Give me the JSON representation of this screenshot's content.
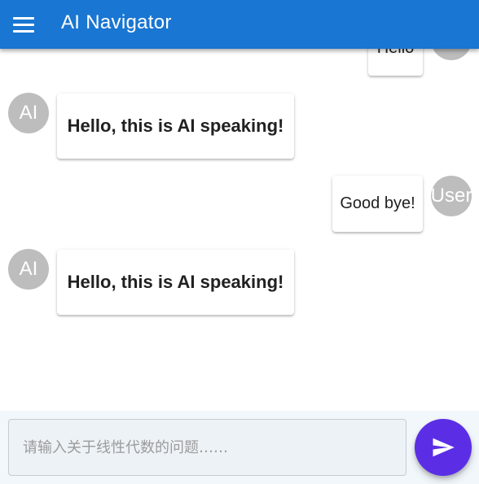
{
  "header": {
    "title": "AI Navigator",
    "menu_icon": "menu-icon"
  },
  "messages": [
    {
      "sender": "user",
      "avatar_text": "",
      "text": "Hello"
    },
    {
      "sender": "ai",
      "avatar_text": "AI",
      "text": "Hello, this is AI speaking!"
    },
    {
      "sender": "user",
      "avatar_text": "User",
      "text": "Good bye!"
    },
    {
      "sender": "ai",
      "avatar_text": "AI",
      "text": "Hello, this is AI speaking!"
    }
  ],
  "composer": {
    "placeholder": "请输入关于线性代数的问题……",
    "value": "",
    "send_icon": "send-icon"
  },
  "colors": {
    "app_bar": "#1976d2",
    "send_button": "#5b2ee6",
    "avatar": "#bdbdbd",
    "input_background": "#edf2f7"
  }
}
